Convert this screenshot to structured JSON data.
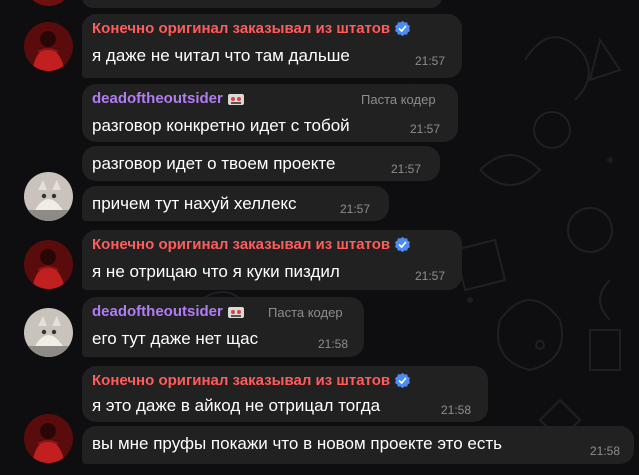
{
  "colors": {
    "background": "#0e0e10",
    "bubble": "#212121",
    "sender_red": "#ff5c5c",
    "sender_purple": "#b17df2",
    "meta_gray": "#8d8d8d",
    "verified_blue": "#4d8cf5"
  },
  "messages": [
    {
      "sender": "Конечно оригинал заказывал из штатов",
      "badge_icon": "verified-icon",
      "text": "я даже не читал что там дальше",
      "time": "21:57"
    },
    {
      "sender": "deadoftheoutsider",
      "badge_icon": "emoji-icon",
      "admin_title": "Паста кодер",
      "text": "разговор конкретно идет с тобой",
      "time": "21:57"
    },
    {
      "text": "разговор идет о твоем проекте",
      "time": "21:57"
    },
    {
      "text": "причем тут нахуй хеллекс",
      "time": "21:57"
    },
    {
      "sender": "Конечно оригинал заказывал из штатов",
      "badge_icon": "verified-icon",
      "text": "я не отрицаю что я куки пиздил",
      "time": "21:57"
    },
    {
      "sender": "deadoftheoutsider",
      "badge_icon": "emoji-icon",
      "admin_title": "Паста кодер",
      "text": "его тут даже нет щас",
      "time": "21:58"
    },
    {
      "sender": "Конечно оригинал заказывал из штатов",
      "badge_icon": "verified-icon",
      "text": "я это даже в айкод не отрицал тогда",
      "time": "21:58"
    },
    {
      "text": "вы мне пруфы покажи что в новом проекте это есть",
      "time": "21:58"
    }
  ]
}
